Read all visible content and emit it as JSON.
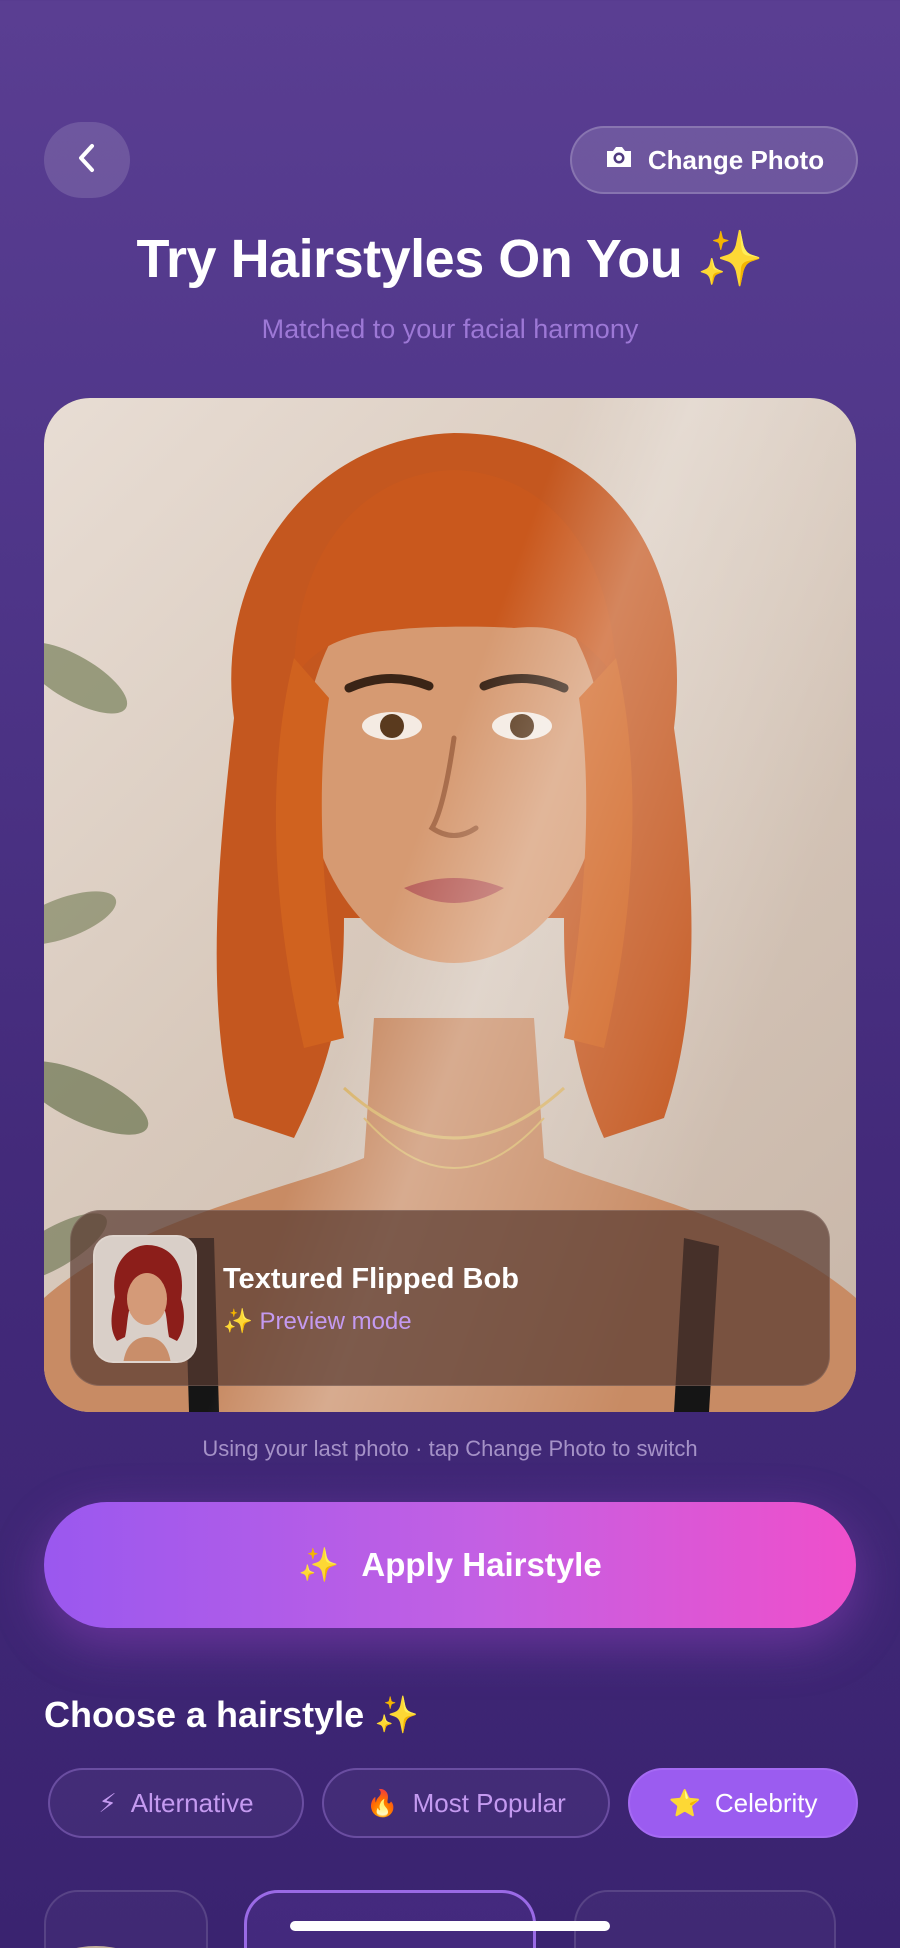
{
  "header": {
    "back_icon": "chevron-left-icon",
    "change_photo_icon": "camera-icon",
    "change_photo_label": "Change Photo"
  },
  "title": "Try Hairstyles On You ✨",
  "subtitle": "Matched to your facial harmony",
  "preview": {
    "style_name": "Textured Flipped Bob",
    "mode_label": "✨ Preview mode"
  },
  "hint": "Using your last photo · tap Change Photo to switch",
  "apply": {
    "icon": "✨",
    "label": "Apply Hairstyle"
  },
  "section_title": "Choose a hairstyle ✨",
  "categories": [
    {
      "icon": "⚡",
      "label": "Alternative",
      "active": false
    },
    {
      "icon": "🔥",
      "label": "Most Popular",
      "active": false
    },
    {
      "icon": "⭐",
      "label": "Celebrity",
      "active": true
    }
  ],
  "colors": {
    "accent": "#9b5cf0",
    "gradient_start": "#9a58ef",
    "gradient_end": "#ef4fcb",
    "muted_text": "#9d78d6"
  }
}
